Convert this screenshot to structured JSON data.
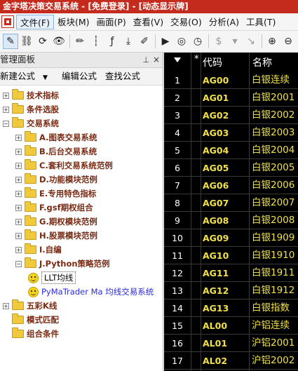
{
  "window": {
    "title": "金字塔决策交易系统 - [免费登录] - [动态显示牌]"
  },
  "menu": [
    {
      "label": "文件(F)",
      "active": true
    },
    {
      "label": "板块(M)"
    },
    {
      "label": "画面(P)"
    },
    {
      "label": "查看(V)"
    },
    {
      "label": "交易(O)"
    },
    {
      "label": "分析(A)"
    },
    {
      "label": "工具(T)"
    }
  ],
  "toolbar": {
    "icons": [
      "pen-icon",
      "link-icon",
      "refresh-icon",
      "binoculars-icon",
      "pencil-icon",
      "candlestick-icon",
      "formula-icon",
      "arrow-down-icon",
      "edit-icon",
      "play-icon",
      "ring-icon",
      "clock-icon",
      "dollar-icon",
      "dropdown-icon",
      "trend-icon",
      "zoom-in-icon",
      "zoom-out-icon",
      "move-icon",
      "zoom-icon"
    ],
    "glyphs": [
      "✎",
      "⛓",
      "⟳",
      "👁",
      "✏",
      "┆",
      "ƒ",
      "⤓",
      "✐",
      "▶",
      "◎",
      "◷",
      "$",
      "▾",
      "↘",
      "⊕",
      "⊖",
      "✥",
      "🔍"
    ]
  },
  "panel": {
    "title": "管理面板",
    "pin": "⊥",
    "close": "×",
    "actions": {
      "new_formula": "新建公式",
      "edit_formula": "编辑公式",
      "find_formula": "查找公式"
    },
    "tree": [
      {
        "label": "技术指标",
        "type": "folder",
        "level": 0,
        "expander": "+"
      },
      {
        "label": "条件选股",
        "type": "folder",
        "level": 0,
        "expander": "+"
      },
      {
        "label": "交易系统",
        "type": "folder",
        "level": 0,
        "expander": "−"
      },
      {
        "label": "A.图表交易系统",
        "type": "folder",
        "level": 1,
        "expander": "+"
      },
      {
        "label": "B.后台交易系统",
        "type": "folder",
        "level": 1,
        "expander": "+"
      },
      {
        "label": "C.套利交易系统范例",
        "type": "folder",
        "level": 1,
        "expander": "+"
      },
      {
        "label": "D.功能模块范例",
        "type": "folder",
        "level": 1,
        "expander": "+"
      },
      {
        "label": "E.专用特色指标",
        "type": "folder",
        "level": 1,
        "expander": "+"
      },
      {
        "label": "F.gsf期权组合",
        "type": "folder",
        "level": 1,
        "expander": "+"
      },
      {
        "label": "G.期权模块范例",
        "type": "folder",
        "level": 1,
        "expander": "+"
      },
      {
        "label": "H.股票模块范例",
        "type": "folder",
        "level": 1,
        "expander": "+"
      },
      {
        "label": "I.自编",
        "type": "folder",
        "level": 1,
        "expander": "+"
      },
      {
        "label": "J.Python策略范例",
        "type": "folder",
        "level": 1,
        "expander": "−"
      },
      {
        "label": "LLT均线",
        "type": "leaf",
        "level": 2,
        "selected": true
      },
      {
        "label": "PyMaTrader Ma 均线交易系统",
        "type": "leaf",
        "level": 2,
        "blue": true
      },
      {
        "label": "五彩K线",
        "type": "folder",
        "level": 0,
        "expander": "+"
      },
      {
        "label": "模式匹配",
        "type": "folder",
        "level": 0,
        "expander": ""
      },
      {
        "label": "组合条件",
        "type": "folder",
        "level": 0,
        "expander": ""
      }
    ]
  },
  "quotes": {
    "headers": {
      "sort": "▼",
      "star": "*",
      "code": "代码",
      "name": "名称"
    },
    "rows": [
      {
        "num": "1",
        "code": "AG00",
        "name": "白银连续"
      },
      {
        "num": "2",
        "code": "AG01",
        "name": "白银2001"
      },
      {
        "num": "3",
        "code": "AG02",
        "name": "白银2002"
      },
      {
        "num": "4",
        "code": "AG03",
        "name": "白银2003"
      },
      {
        "num": "5",
        "code": "AG04",
        "name": "白银2004"
      },
      {
        "num": "6",
        "code": "AG05",
        "name": "白银2005"
      },
      {
        "num": "7",
        "code": "AG06",
        "name": "白银2006"
      },
      {
        "num": "8",
        "code": "AG07",
        "name": "白银2007"
      },
      {
        "num": "9",
        "code": "AG08",
        "name": "白银2008"
      },
      {
        "num": "10",
        "code": "AG09",
        "name": "白银1909"
      },
      {
        "num": "11",
        "code": "AG10",
        "name": "白银1910"
      },
      {
        "num": "12",
        "code": "AG11",
        "name": "白银1911"
      },
      {
        "num": "13",
        "code": "AG12",
        "name": "白银1912"
      },
      {
        "num": "14",
        "code": "AG13",
        "name": "白银指数"
      },
      {
        "num": "15",
        "code": "AL00",
        "name": "沪铝连续"
      },
      {
        "num": "16",
        "code": "AL01",
        "name": "沪铝2001"
      },
      {
        "num": "17",
        "code": "AL02",
        "name": "沪铝2002"
      }
    ]
  },
  "colors": {
    "title_bar": "#c42b1c",
    "quote_bg": "#000000",
    "quote_code": "#f0e04a",
    "tree_text": "#7a2a12",
    "link_blue": "#2a2adf"
  }
}
